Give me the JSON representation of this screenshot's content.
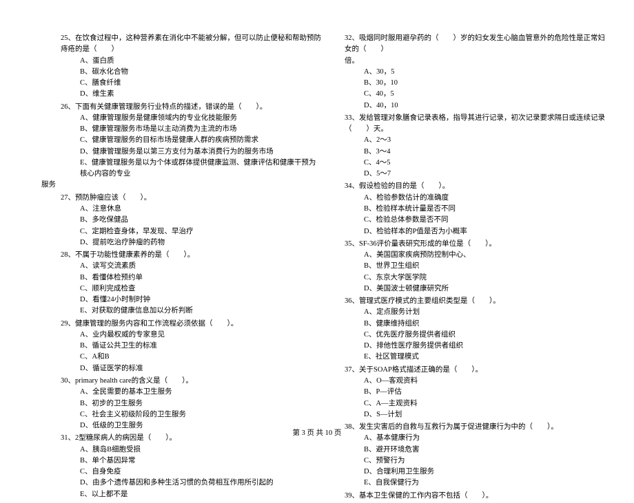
{
  "left": [
    {
      "stem": "25、在饮食过程中，这种营养素在消化中不能被分解，但可以防止便秘和帮助预防痔疮的是（　　）",
      "opts": [
        "A、蛋白质",
        "B、碳水化合物",
        "C、膳食纤维",
        "D、维生素"
      ]
    },
    {
      "stem": "26、下面有关健康管理服务行业特点的描述，错误的是（　　）。",
      "opts": [
        "A、健康管理服务是健康领域内的专业化技能服务",
        "B、健康管理服务市场是以主动消费为主流的市场",
        "C、健康管理服务的目标市场是健康人群的疾病预防需求",
        "D、健康管理服务是以第三方支付为基本消费行为的服务市场",
        "E、健康管理服务是以为个体或群体提供健康监测、健康评估和健康干预为核心内容的专业"
      ],
      "trail": "服务"
    },
    {
      "stem": "27、预防肿瘤应该（　　）。",
      "opts": [
        "A、注意休息",
        "B、多吃保健品",
        "C、定期检查身体，早发现、早治疗",
        "D、提前吃治疗肿瘤的药物"
      ]
    },
    {
      "stem": "28、不属于功能性健康素养的是（　　）。",
      "opts": [
        "A、读写交流素质",
        "B、看懂体检预约单",
        "C、顺利完成检查",
        "D、看懂24小时制时钟",
        "E、对获取的健康信息加以分析判断"
      ]
    },
    {
      "stem": "29、健康管理的服务内容和工作流程必须依据（　　）。",
      "opts": [
        "A、业内最权威的专家意见",
        "B、循证公共卫生的标准",
        "C、A和B",
        "D、循证医学的标准"
      ]
    },
    {
      "stem": "30、primary health care的含义是（　　）。",
      "opts": [
        "A、全民需要的基本卫生服务",
        "B、初步的卫生服务",
        "C、社会主义初级阶段的卫生服务",
        "D、低级的卫生服务"
      ]
    },
    {
      "stem": "31、2型糖尿病人的病因是（　　）。",
      "opts": [
        "A、胰岛B细胞受损",
        "B、单个基因异常",
        "C、自身免疫",
        "D、由多个遗传基因和多种生活习惯的负荷相互作用所引起的",
        "E、以上都不是"
      ]
    }
  ],
  "right": [
    {
      "stem": "32、吸烟同时服用避孕药的（　　）岁的妇女发生心脑血管意外的危险性是正常妇女的（　　）",
      "trailTop": "倍。",
      "opts": [
        "A、30，5",
        "B、30，10",
        "C、40，5",
        "D、40，10"
      ]
    },
    {
      "stem": "33、发给管理对象膳食记录表格，指导其进行记录，初次记录要求隔日或连续记录（　　）天。",
      "opts": [
        "A、2～3",
        "B、3～4",
        "C、4～5",
        "D、5～7"
      ]
    },
    {
      "stem": "34、假设检验的目的是（　　）。",
      "opts": [
        "A、检验参数估计的准确度",
        "B、检验样本统计量是否不同",
        "C、检验总体参数是否不同",
        "D、检验样本的P值是否为小概率"
      ]
    },
    {
      "stem": "35、SF-36评价量表研究形成的单位是（　　）。",
      "opts": [
        "A、美国国家疾病预防控制中心、",
        "B、世界卫生组织",
        "C、东京大学医学院",
        "D、美国波士顿健康研究所"
      ]
    },
    {
      "stem": "36、管理式医疗模式的主要组织类型是（　　）。",
      "opts": [
        "A、定点服务计划",
        "B、健康维持组织",
        "C、优先医疗服务提供者组织",
        "D、排他性医疗服务提供者组织",
        "E、社区管理模式"
      ]
    },
    {
      "stem": "37、关于SOAP格式描述正确的是（　　）。",
      "opts": [
        "A、O—客观资料",
        "B、P—评估",
        "C、A—主观资料",
        "D、S—计划"
      ]
    },
    {
      "stem": "38、发生灾害后的自救与互救行为属于促进健康行为中的（　　）。",
      "opts": [
        "A、基本健康行为",
        "B、避开环境危害",
        "C、预警行为",
        "D、合理利用卫生服务",
        "E、自我保健行为"
      ]
    },
    {
      "stem": "39、基本卫生保健的工作内容不包括（　　）。",
      "opts": []
    }
  ],
  "footer": "第 3 页 共 10 页"
}
